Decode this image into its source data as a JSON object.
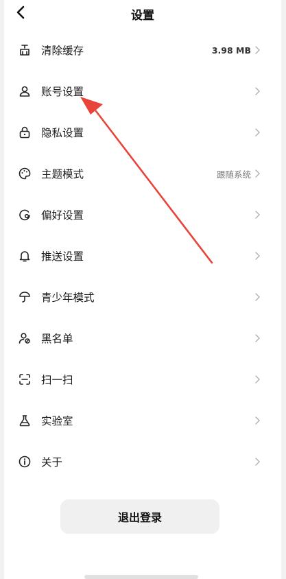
{
  "header": {
    "title": "设置",
    "back_icon": "chevron-left-icon"
  },
  "settings": {
    "items": [
      {
        "label": "清除缓存",
        "value": "3.98 MB",
        "icon": "broom-icon"
      },
      {
        "label": "账号设置",
        "value": "",
        "icon": "user-icon"
      },
      {
        "label": "隐私设置",
        "value": "",
        "icon": "lock-icon"
      },
      {
        "label": "主题模式",
        "value": "跟随系统",
        "icon": "palette-icon"
      },
      {
        "label": "偏好设置",
        "value": "",
        "icon": "preference-icon"
      },
      {
        "label": "推送设置",
        "value": "",
        "icon": "bell-icon"
      },
      {
        "label": "青少年模式",
        "value": "",
        "icon": "sprout-icon"
      },
      {
        "label": "黑名单",
        "value": "",
        "icon": "blocked-user-icon"
      },
      {
        "label": "扫一扫",
        "value": "",
        "icon": "scan-icon"
      },
      {
        "label": "实验室",
        "value": "",
        "icon": "flask-icon"
      },
      {
        "label": "关于",
        "value": "",
        "icon": "info-icon"
      }
    ]
  },
  "logout": {
    "label": "退出登录"
  },
  "annotation": {
    "color": "#e8443a",
    "icon": "red-arrow-pointer"
  },
  "theme": {
    "text": "#1a1a1a",
    "secondary": "#777777",
    "chevron": "#b0b0b0",
    "button_bg": "#f0f0f0"
  }
}
